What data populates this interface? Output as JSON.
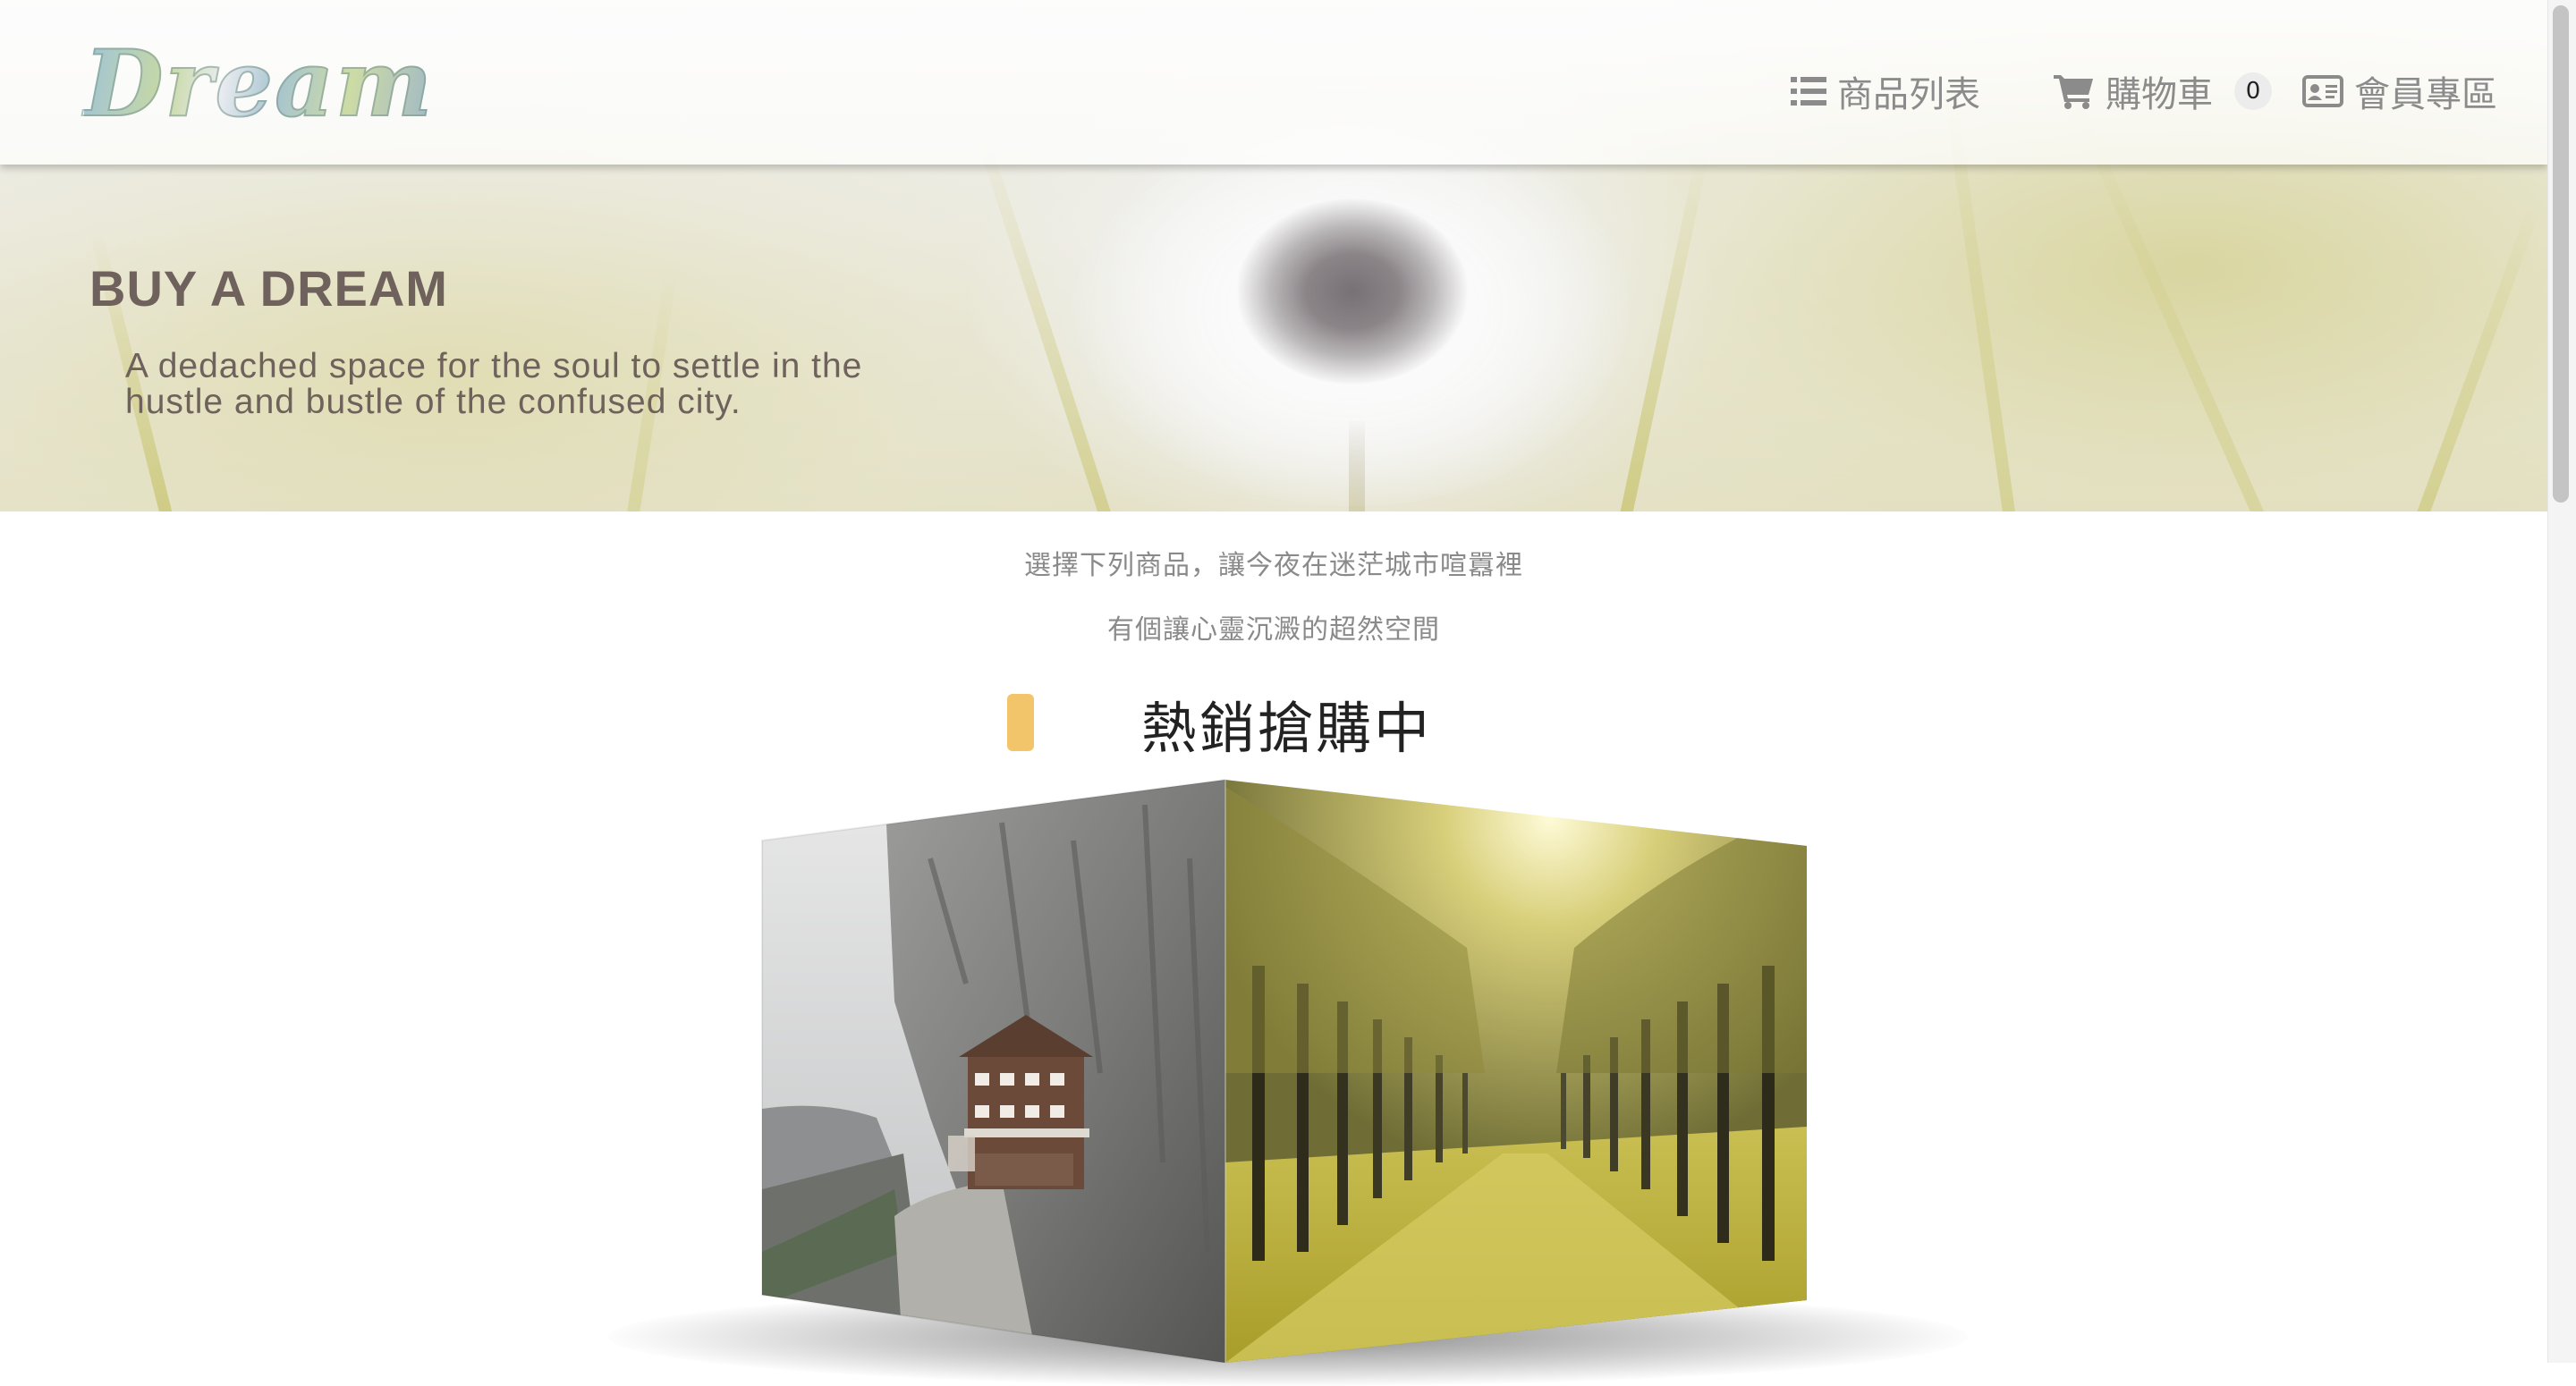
{
  "brand": {
    "logo_text": "Dream"
  },
  "nav": {
    "products": {
      "label": "商品列表",
      "icon": "list-icon"
    },
    "cart": {
      "label": "購物車",
      "icon": "cart-icon",
      "count": "0"
    },
    "member": {
      "label": "會員專區",
      "icon": "id-card-icon"
    }
  },
  "hero": {
    "title": "BUY A DREAM",
    "subtitle": "A dedached space for the soul to settle in the hustle and bustle of the confused city."
  },
  "intro": {
    "line1": "選擇下列商品，讓今夜在迷茫城市喧囂裡",
    "line2": "有個讓心靈沉澱的超然空間"
  },
  "section": {
    "title": "熱銷搶購中",
    "accent_color": "#f3c56a"
  },
  "product_cube": {
    "left_face_image": "cliffside-house-photo",
    "right_face_image": "sunlit-forest-avenue-photo"
  }
}
